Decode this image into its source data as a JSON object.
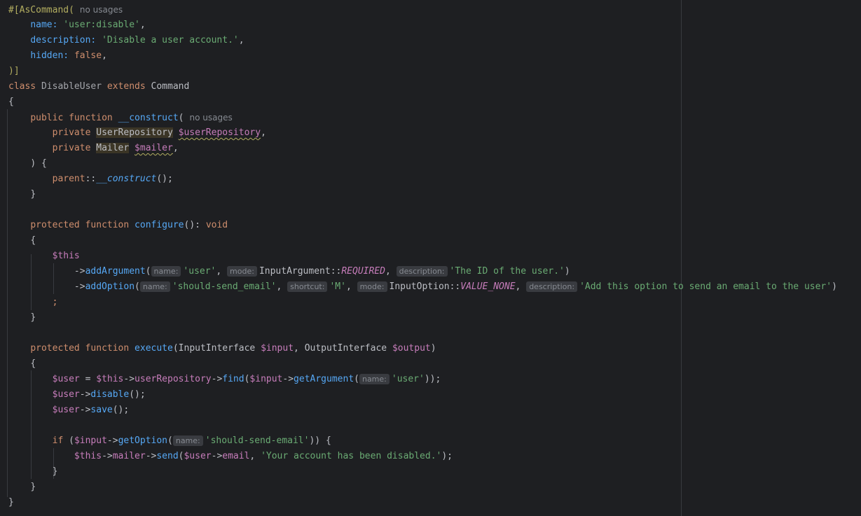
{
  "editor": {
    "inline_hints": {
      "no_usages": "no usages",
      "name": "name:",
      "mode": "mode:",
      "description": "description:",
      "shortcut": "shortcut:"
    },
    "lines": {
      "l1_attr": "#[AsCommand(",
      "l2_name_key": "name:",
      "l2_name_val": "'user:disable'",
      "l3_desc_key": "description:",
      "l3_desc_val": "'Disable a user account.'",
      "l4_hidden_key": "hidden:",
      "l4_hidden_val": "false",
      "l5_close": ")]",
      "l6_class": "class",
      "l6_name": "DisableUser",
      "l6_extends": "extends",
      "l6_parent": "Command",
      "l7_brace": "{",
      "l8_public": "public",
      "l8_function": "function",
      "l8_name": "__construct",
      "l9_private": "private",
      "l9_type": "UserRepository",
      "l9_var": "$userRepository",
      "l10_private": "private",
      "l10_type": "Mailer",
      "l10_var": "$mailer",
      "l11_close": ") {",
      "l12_parent": "parent",
      "l12_call": "__construct",
      "l13_close": "}",
      "l15_protected": "protected",
      "l15_function": "function",
      "l15_name": "configure",
      "l15_void": "void",
      "l16_open": "{",
      "l17_this": "$this",
      "l18_method": "addArgument",
      "l18_arg1": "'user'",
      "l18_class": "InputArgument",
      "l18_const": "REQUIRED",
      "l18_desc": "'The ID of the user.'",
      "l19_method": "addOption",
      "l19_arg1": "'should-send_email'",
      "l19_short": "'M'",
      "l19_class": "InputOption",
      "l19_const": "VALUE_NONE",
      "l19_desc": "'Add this option to send an email to the user'",
      "l20_semi": ";",
      "l21_close": "}",
      "l23_protected": "protected",
      "l23_function": "function",
      "l23_name": "execute",
      "l23_t1": "InputInterface",
      "l23_v1": "$input",
      "l23_t2": "OutputInterface",
      "l23_v2": "$output",
      "l24_open": "{",
      "l25_user": "$user",
      "l25_this": "$this",
      "l25_prop": "userRepository",
      "l25_find": "find",
      "l25_input": "$input",
      "l25_getarg": "getArgument",
      "l25_val": "'user'",
      "l26_user": "$user",
      "l26_call": "disable",
      "l27_user": "$user",
      "l27_call": "save",
      "l29_if": "if",
      "l29_input": "$input",
      "l29_getopt": "getOption",
      "l29_val": "'should-send-email'",
      "l30_this": "$this",
      "l30_prop": "mailer",
      "l30_send": "send",
      "l30_user": "$user",
      "l30_email": "email",
      "l30_msg": "'Your account has been disabled.'",
      "l31_close": "}",
      "l32_close": "}",
      "l33_close": "}"
    }
  }
}
